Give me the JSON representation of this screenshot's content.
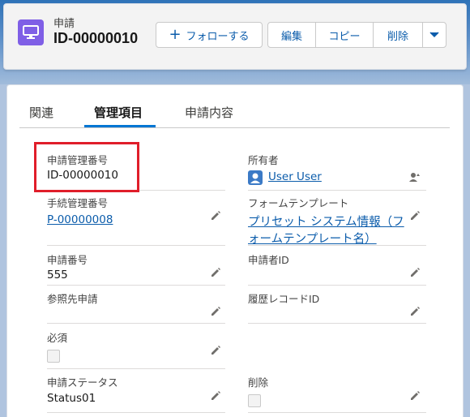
{
  "header": {
    "object_label": "申請",
    "record_title": "ID-00000010",
    "object_icon": "desktop-icon",
    "icon_color": "#7f5fe6",
    "buttons": {
      "follow": "フォローする",
      "edit": "編集",
      "copy": "コピー",
      "delete": "削除"
    }
  },
  "tabs": [
    "関連",
    "管理項目",
    "申請内容"
  ],
  "active_tab": "管理項目",
  "fields": {
    "app_mgmt_no": {
      "label": "申請管理番号",
      "value": "ID-00000010"
    },
    "owner": {
      "label": "所有者",
      "value": "User User"
    },
    "proc_mgmt_no": {
      "label": "手続管理番号",
      "value": "P-00000008"
    },
    "form_template": {
      "label": "フォームテンプレート",
      "value_line1": "プリセット システム情報（フ",
      "value_line2": "ォームテンプレート名）"
    },
    "app_no": {
      "label": "申請番号",
      "value": "555"
    },
    "applicant_id": {
      "label": "申請者ID",
      "value": ""
    },
    "ref_app": {
      "label": "参照先申請",
      "value": ""
    },
    "history_record_id": {
      "label": "履歴レコードID",
      "value": ""
    },
    "required": {
      "label": "必須",
      "checked": false
    },
    "app_status": {
      "label": "申請ステータス",
      "value": "Status01"
    },
    "deleted": {
      "label": "削除",
      "checked": false
    }
  },
  "colors": {
    "accent": "#0176d3",
    "link": "#0b5cab",
    "highlight": "#e01e2a"
  }
}
